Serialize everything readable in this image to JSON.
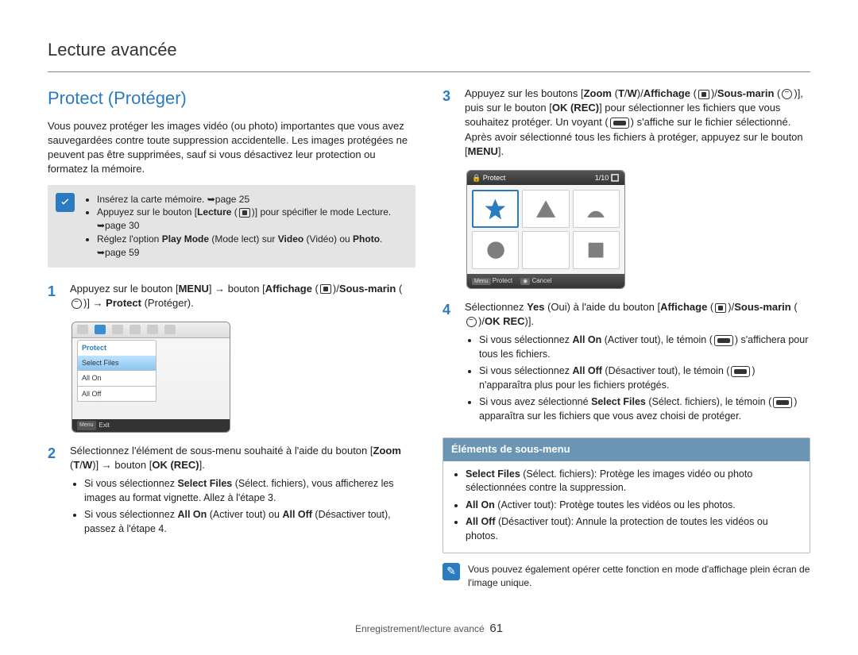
{
  "breadcrumb": "Lecture avancée",
  "section_title": "Protect (Protéger)",
  "intro": "Vous pouvez protéger les images vidéo (ou photo) importantes que vous avez sauvegardées contre toute suppression accidentelle. Les images protégées ne peuvent pas être supprimées, sauf si vous désactivez leur protection ou formatez la mémoire.",
  "prereq": {
    "items": [
      "Insérez la carte mémoire. ➥page 25",
      "Appuyez sur le bouton [Lecture (▣)] pour spécifier le mode Lecture. ➥page 30",
      "Réglez l'option Play Mode (Mode lect) sur Video (Vidéo) ou Photo. ➥page 59"
    ]
  },
  "steps_left": [
    {
      "num": "1",
      "text_parts": [
        "Appuyez sur le bouton [",
        "MENU",
        "] → bouton [",
        "Affichage",
        " (▣)/",
        "Sous-marin",
        " (☺)] → ",
        "Protect",
        " (Protéger)."
      ]
    },
    {
      "num": "2",
      "text_parts": [
        "Sélectionnez l'élément de sous-menu souhaité à l'aide du bouton [",
        "Zoom",
        " (",
        "T",
        "/",
        "W",
        ")] → bouton [",
        "OK (REC)",
        "]."
      ],
      "bullets": [
        "Si vous sélectionnez Select Files (Sélect. fichiers), vous afficherez les images au format vignette. Allez à l'étape 3.",
        "Si vous sélectionnez All On (Activer tout) ou All Off (Désactiver tout), passez à l'étape 4."
      ]
    }
  ],
  "screen1": {
    "menu_header": "Protect",
    "items": [
      "Select Files",
      "All On",
      "All Off"
    ],
    "footer_btn": "Menu",
    "footer_label": "Exit"
  },
  "steps_right": [
    {
      "num": "3",
      "text_parts": [
        "Appuyez sur les boutons [",
        "Zoom",
        " (",
        "T",
        "/",
        "W",
        ")/",
        "Affichage",
        " (▣)/",
        "Sous-marin",
        " (☺)], puis sur le bouton [",
        "OK (REC)",
        "] pour sélectionner les fichiers que vous souhaitez protéger. Un voyant (⊘) s'affiche sur le fichier sélectionné. Après avoir sélectionné tous les fichiers à protéger, appuyez sur le bouton [",
        "MENU",
        "]."
      ]
    },
    {
      "num": "4",
      "text_parts": [
        "Sélectionnez ",
        "Yes",
        " (Oui) à l'aide du bouton [",
        "Affichage",
        " (▣)/",
        "Sous-marin",
        " (☺)/",
        "OK REC",
        ")]."
      ],
      "bullets": [
        "Si vous sélectionnez All On (Activer tout), le témoin (⊘) s'affichera pour tous les fichiers.",
        "Si vous sélectionnez All Off (Désactiver tout), le témoin (⊘) n'apparaîtra plus pour les fichiers protégés.",
        "Si vous avez sélectionné Select Files (Sélect. fichiers), le témoin (⊘) apparaîtra sur les fichiers que vous avez choisi de protéger."
      ]
    }
  ],
  "screen2": {
    "title": "Protect",
    "counter": "1/10",
    "bot_left_btn": "Menu",
    "bot_left_label": "Protect",
    "bot_right_btn": "◉",
    "bot_right_label": "Cancel"
  },
  "submenu": {
    "header": "Éléments de sous-menu",
    "items": [
      {
        "bold": "Select Files",
        "rest": " (Sélect. fichiers): Protège les images vidéo ou photo sélectionnées contre la suppression."
      },
      {
        "bold": "All On",
        "rest": " (Activer tout): Protège toutes les vidéos ou les photos."
      },
      {
        "bold": "All Off",
        "rest": " (Désactiver tout): Annule la protection de toutes les vidéos ou photos."
      }
    ]
  },
  "tip": "Vous pouvez également opérer cette fonction en mode d'affichage plein écran de l'image unique.",
  "footer": {
    "label": "Enregistrement/lecture avancé",
    "page": "61"
  }
}
